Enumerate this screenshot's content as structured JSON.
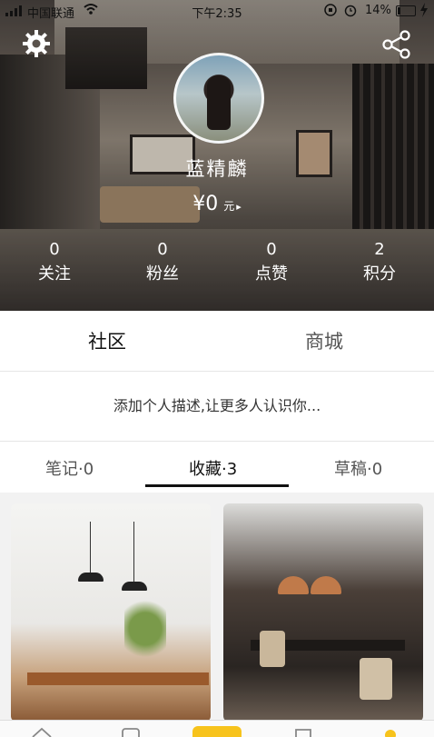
{
  "status_bar": {
    "carrier": "中国联通",
    "time": "下午2:35",
    "battery": "14%",
    "battery_level": 0.14
  },
  "header": {
    "settings_icon": "gear-icon",
    "share_icon": "share-icon",
    "username": "蓝精麟",
    "balance_amount": "¥0",
    "balance_unit": "元",
    "balance_arrow": "▸"
  },
  "stats": [
    {
      "value": "0",
      "label": "关注"
    },
    {
      "value": "0",
      "label": "粉丝"
    },
    {
      "value": "0",
      "label": "点赞"
    },
    {
      "value": "2",
      "label": "积分"
    }
  ],
  "main_tabs": [
    {
      "label": "社区",
      "active": true
    },
    {
      "label": "商城",
      "active": false
    }
  ],
  "description_prompt": "添加个人描述,让更多人认识你...",
  "sub_tabs": [
    {
      "label": "笔记·0",
      "active": false
    },
    {
      "label": "收藏·3",
      "active": true
    },
    {
      "label": "草稿·0",
      "active": false
    }
  ],
  "colors": {
    "accent": "#f7c31c",
    "active_underline": "#111111"
  }
}
